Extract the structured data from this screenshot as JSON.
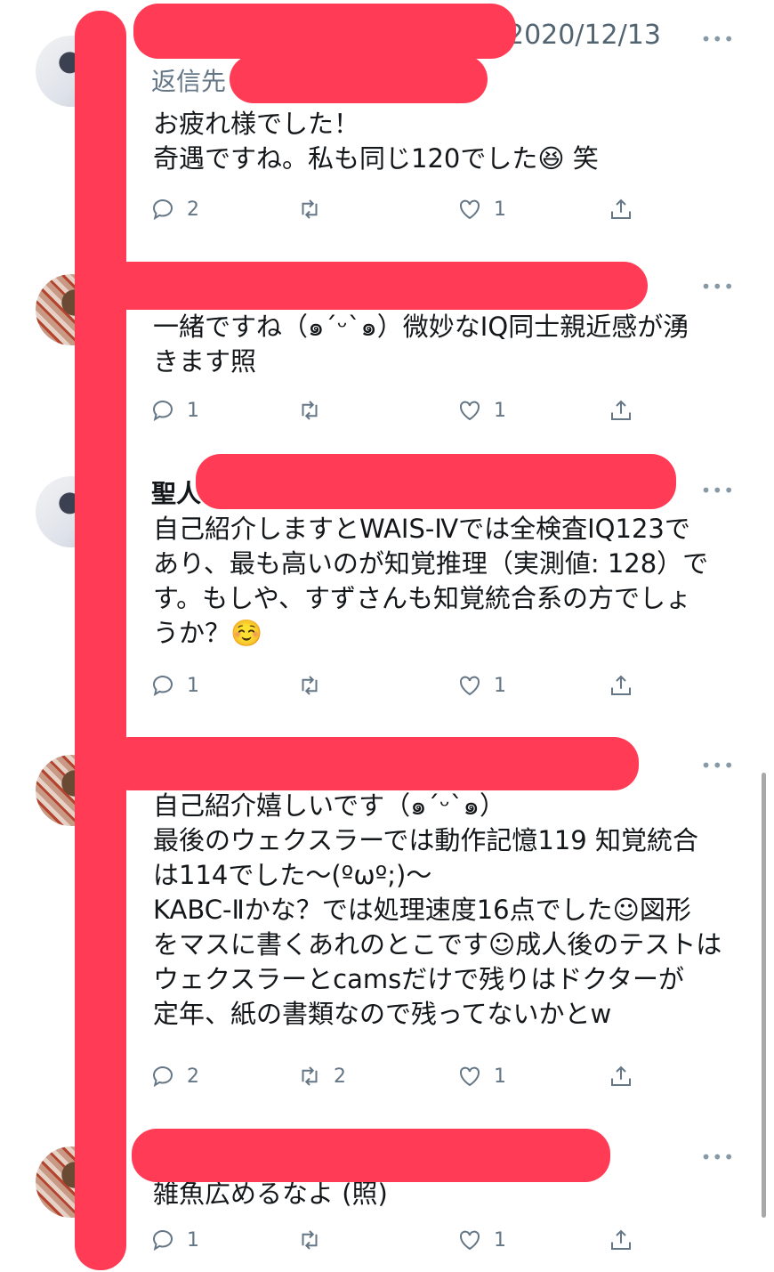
{
  "tweets": [
    {
      "date": "2020/12/13",
      "reply_to_label": "返信先",
      "text": "お疲れ様でした！\n奇遇ですね。私も同じ120でした😆 笑",
      "replies": "2",
      "retweets": "",
      "likes": "1"
    },
    {
      "text": "一緒ですね（๑´ᵕ`๑）微妙なIQ同士親近感が湧\nきます照",
      "replies": "1",
      "retweets": "",
      "likes": "1"
    },
    {
      "author": "聖人",
      "text": "自己紹介しますとWAIS-Ⅳでは全検査IQ123で\nあり、最も高いのが知覚推理（実測値: 128）で\nす。もしや、すずさんも知覚統合系の方でしょ\nうか？☺️",
      "replies": "1",
      "retweets": "",
      "likes": "1"
    },
    {
      "text": "自己紹介嬉しいです（๑´ᵕ`๑）\n最後のウェクスラーでは動作記憶119 知覚統合\nは114でした〜(ºωº;)〜\nKABC-Ⅱかな？では処理速度16点でした☺図形\nをマスに書くあれのとこです☺成人後のテストは\nウェクスラーとcamsだけで残りはドクターが\n定年、紙の書類なので残ってないかとw",
      "replies": "2",
      "retweets": "2",
      "likes": "1"
    },
    {
      "text": "雑魚広めるなよ (照)",
      "replies": "1",
      "retweets": "",
      "likes": "1"
    }
  ],
  "more_glyph": "•••",
  "colors": {
    "redaction": "#ff3b55",
    "muted": "#657786"
  }
}
